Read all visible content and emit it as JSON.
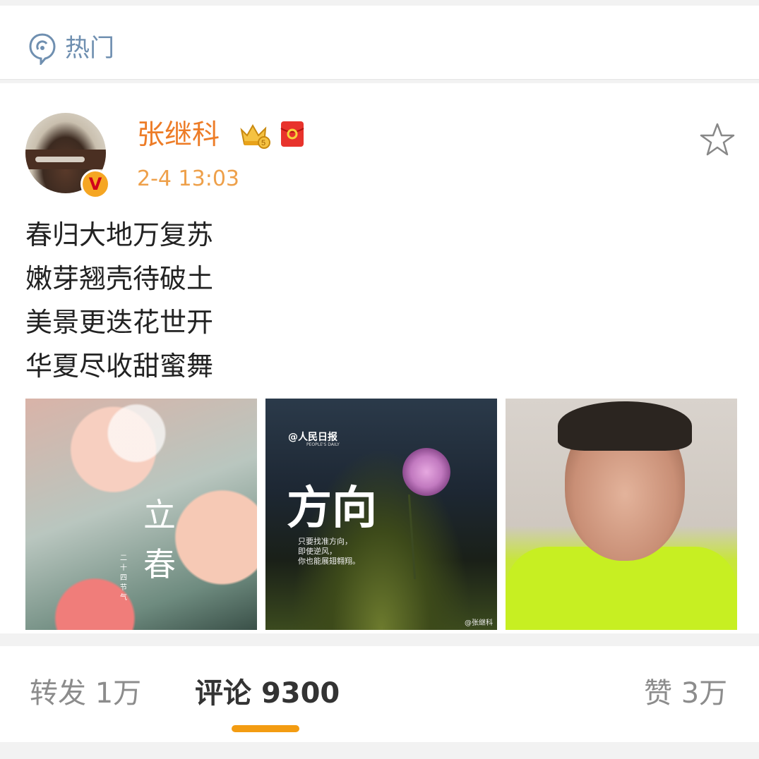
{
  "header": {
    "hot_label": "热门",
    "hot_icon": "location-bubble-icon"
  },
  "post": {
    "username": "张继科",
    "badges": [
      "crown-vip-icon",
      "red-packet-icon"
    ],
    "verified_badge": "V",
    "timestamp": "2-4 13:03",
    "lines": [
      "春归大地万复苏",
      "嫩芽翘壳待破土",
      "美景更迭花世开",
      "华夏尽收甜蜜舞"
    ],
    "images": [
      {
        "big_text": "立春",
        "small_text": "二十四节气"
      },
      {
        "logo": "@人民日报",
        "logo_sub": "PEOPLE'S DAILY",
        "title": "方向",
        "sub_lines": [
          "只要找准方向，",
          "即使逆风，",
          "你也能展翅翱翔。"
        ],
        "watermark": "@张继科"
      },
      {
        "description": "selfie"
      }
    ]
  },
  "actions": {
    "repost_label": "转发",
    "repost_count": "1万",
    "comment_label": "评论",
    "comment_count": "9300",
    "like_label": "赞",
    "like_count": "3万",
    "active_tab_color": "#f39c12"
  }
}
